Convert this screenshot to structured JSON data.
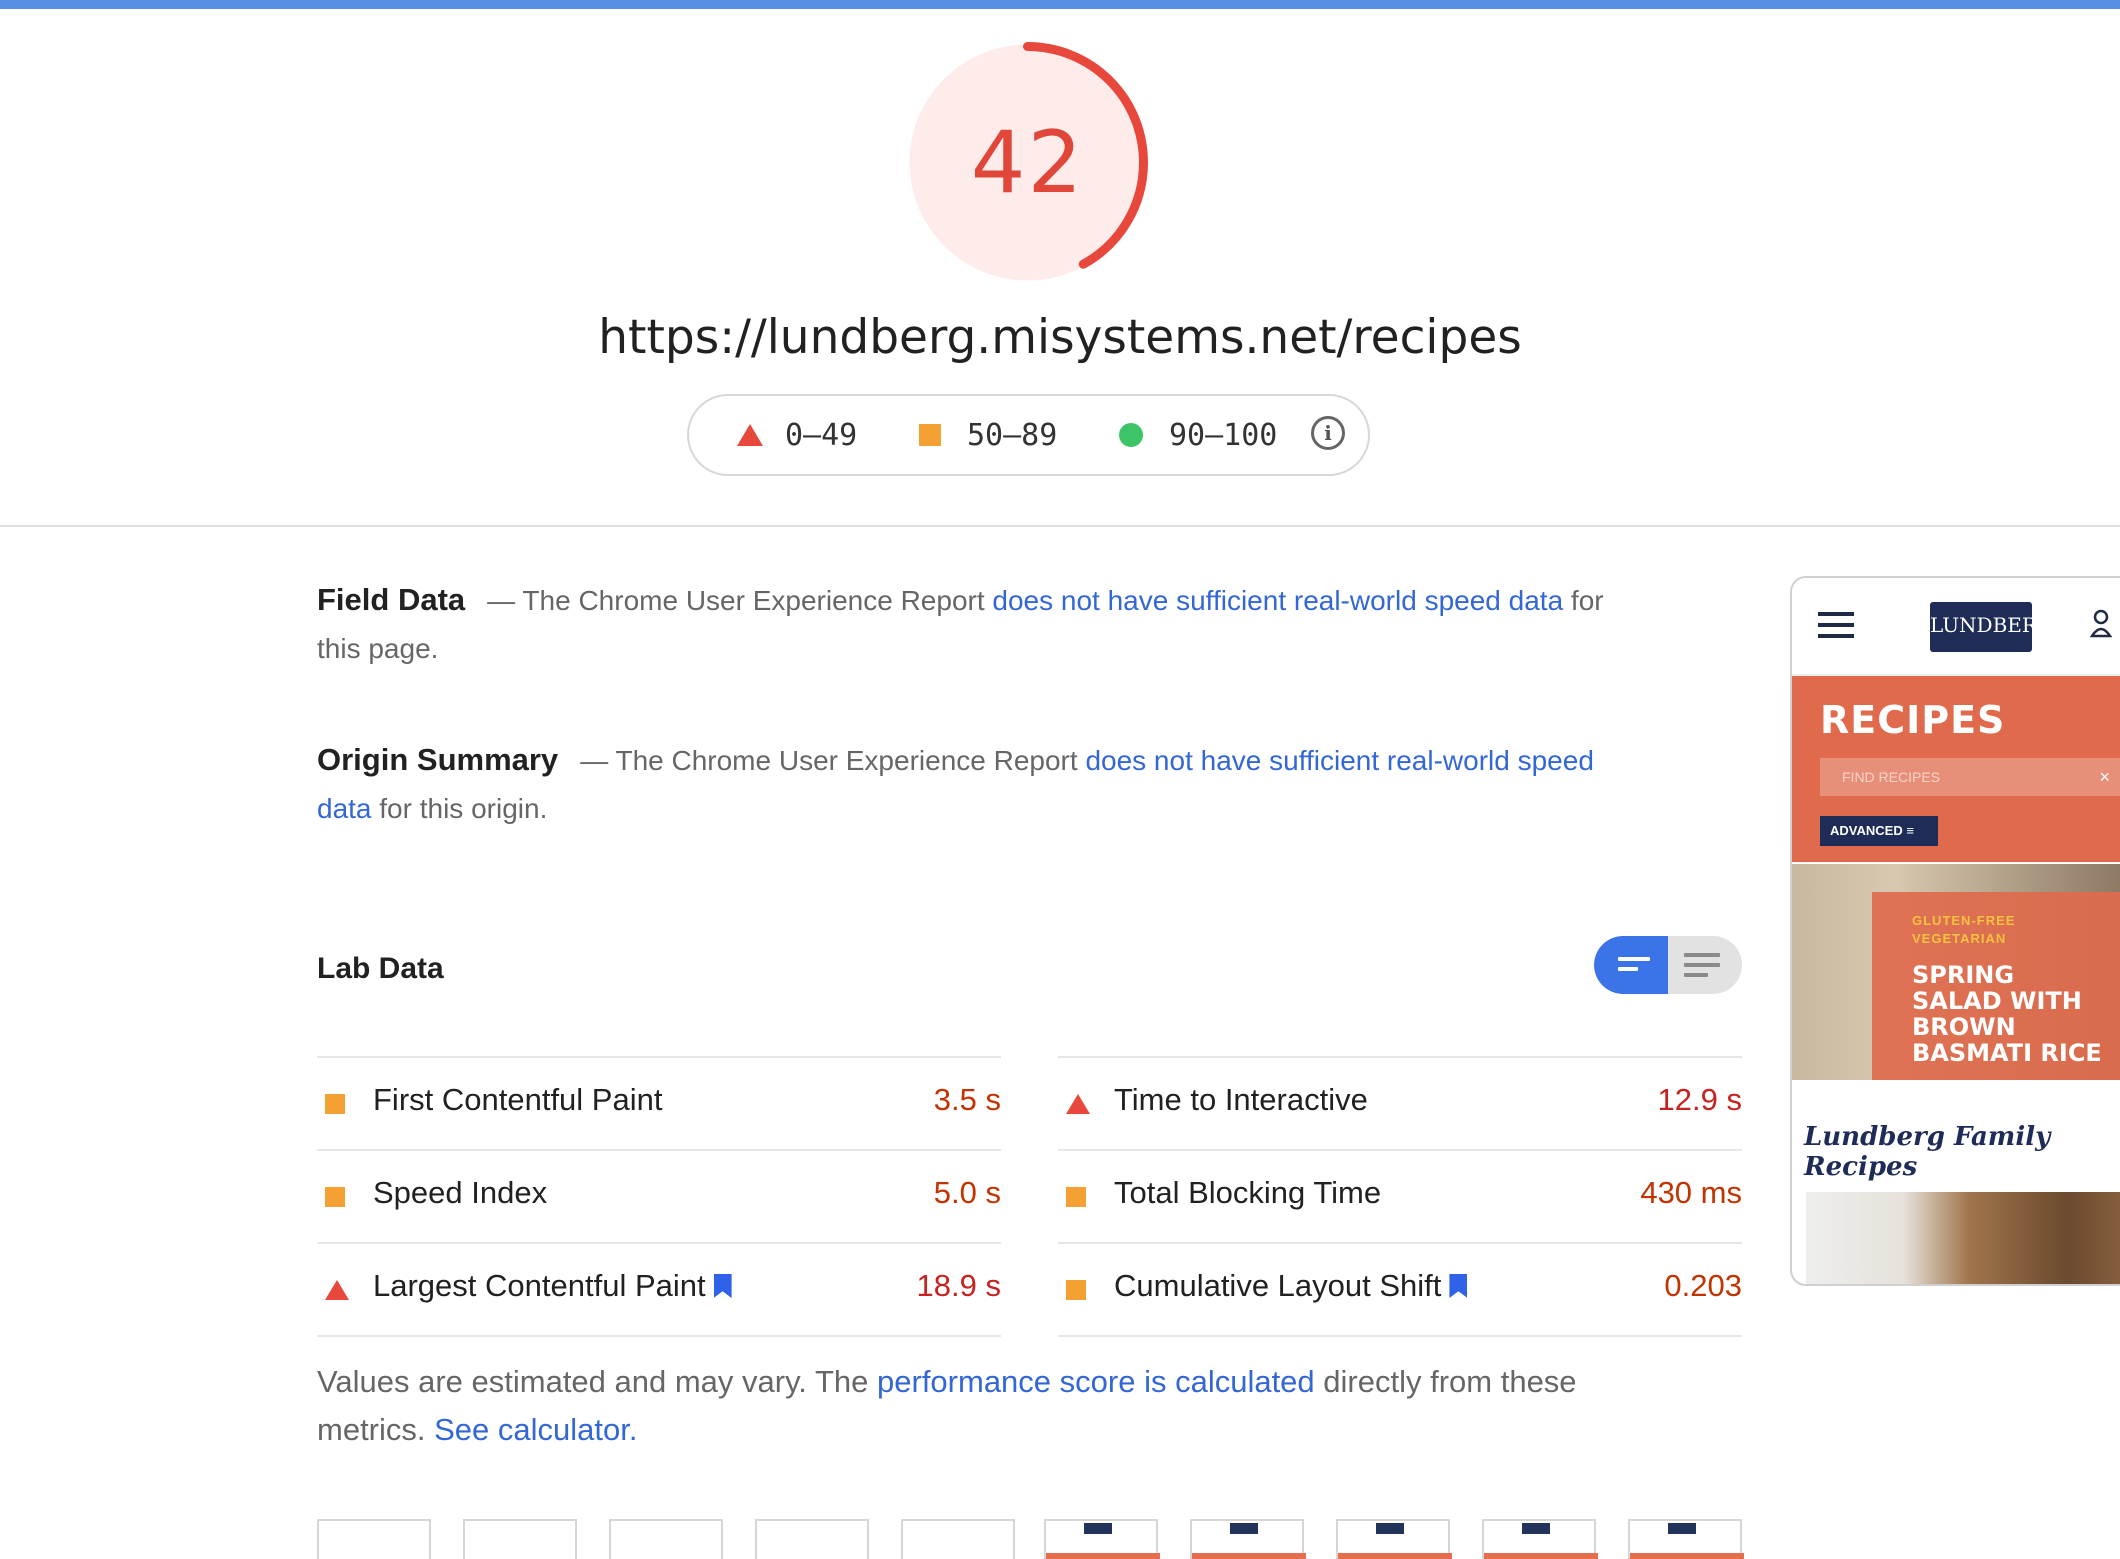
{
  "score": {
    "value": "42",
    "fraction": 0.42,
    "color": "#e8473b"
  },
  "url": "https://lundberg.misystems.net/recipes",
  "legend": {
    "poor": "0–49",
    "average": "50–89",
    "good": "90–100"
  },
  "field_data": {
    "title": "Field Data",
    "prefix": "— The Chrome User Experience Report",
    "link": "does not have sufficient real-world speed data",
    "suffix": "for this page."
  },
  "origin_summary": {
    "title": "Origin Summary",
    "prefix": "— The Chrome User Experience Report",
    "link": "does not have sufficient real-world speed data",
    "suffix": "for this origin."
  },
  "lab": {
    "title": "Lab Data",
    "left": [
      {
        "name": "First Contentful Paint",
        "value": "3.5 s",
        "rating": "average"
      },
      {
        "name": "Speed Index",
        "value": "5.0 s",
        "rating": "average"
      },
      {
        "name": "Largest Contentful Paint",
        "value": "18.9 s",
        "rating": "poor"
      }
    ],
    "right": [
      {
        "name": "Time to Interactive",
        "value": "12.9 s",
        "rating": "poor"
      },
      {
        "name": "Total Blocking Time",
        "value": "430 ms",
        "rating": "average"
      },
      {
        "name": "Cumulative Layout Shift",
        "value": "0.203",
        "rating": "average"
      }
    ]
  },
  "note": {
    "prefix": "Values are estimated and may vary. The",
    "link1": "performance score is calculated",
    "middle": "directly from these metrics.",
    "link2": "See calculator."
  },
  "preview": {
    "logo": "LUNDBERG",
    "hero_title": "RECIPES",
    "search_placeholder": "FIND RECIPES",
    "advanced": "ADVANCED",
    "tags": "GLUTEN-FREE\nVEGETARIAN",
    "feature_title": "SPRING SALAD WITH BROWN BASMATI RICE",
    "script_title": "Lundberg Family Recipes"
  }
}
